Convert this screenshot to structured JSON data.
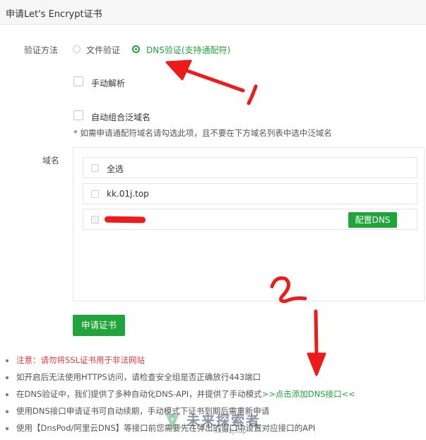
{
  "header": {
    "title": "申请Let's Encrypt证书"
  },
  "verify": {
    "label": "验证方法",
    "option_file": "文件验证",
    "option_dns": "DNS验证(支持通配符)",
    "selected": "dns"
  },
  "manual_parse": {
    "label": "手动解析",
    "checked": false
  },
  "auto_wildcard": {
    "label": "自动组合泛域名",
    "checked": false,
    "note": "* 如需申请通配符域名请勾选此项，且不要在下方域名列表中选中泛域名"
  },
  "domains": {
    "label": "域名",
    "select_all": "全选",
    "items": [
      {
        "name": "kk.01j.top",
        "checked": false
      },
      {
        "name": "",
        "checked": false,
        "redacted": true,
        "action": "配置DNS"
      }
    ]
  },
  "apply_button": "申请证书",
  "bullets": [
    {
      "text": "注意：请勿将SSL证书用于非法网站",
      "style": "red"
    },
    {
      "text": "如开启后无法使用HTTPS访问，请检查安全组是否正确放行443端口"
    },
    {
      "text": "在DNS验证中，我们提供了多种自动化DNS-API，并提供了手动模式",
      "link": ">>点击添加DNS接口<<"
    },
    {
      "text": "使用DNS接口申请证书可自动续期，手动模式下证书到期后需重新申请"
    },
    {
      "text": "使用【DnsPod/阿里云DNS】等接口前您需要先在弹出的窗口中设置对应接口的API"
    }
  ],
  "annotations": {
    "mark1": "1",
    "mark2": "2"
  },
  "watermark": {
    "title": "未来探索者",
    "subtitle": "kk.01j.top"
  },
  "colors": {
    "accent": "#20a53a",
    "warning": "#e4393c",
    "annotation": "#ee1b1b"
  }
}
